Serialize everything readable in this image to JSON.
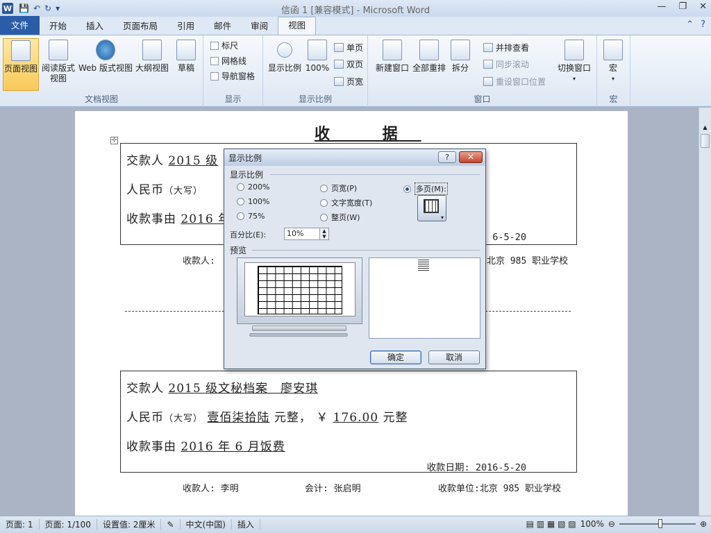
{
  "window": {
    "title": "信函 1 [兼容模式] - Microsoft Word",
    "word_logo": "W"
  },
  "ribbon": {
    "tabs": [
      "文件",
      "开始",
      "插入",
      "页面布局",
      "引用",
      "邮件",
      "审阅",
      "视图"
    ],
    "active_tab": "视图",
    "groups": {
      "doc_views": {
        "label": "文档视图",
        "buttons": [
          "页面视图",
          "阅读版式\n视图",
          "Web 版式视图",
          "大纲视图",
          "草稿"
        ]
      },
      "show": {
        "label": "显示",
        "items": [
          "标尺",
          "网格线",
          "导航窗格"
        ]
      },
      "zoom": {
        "label": "显示比例",
        "buttons": [
          "显示比例",
          "100%"
        ],
        "small": [
          "单页",
          "双页",
          "页宽"
        ]
      },
      "window": {
        "label": "窗口",
        "buttons": [
          "新建窗口",
          "全部重排",
          "拆分"
        ],
        "small": [
          "并排查看",
          "同步滚动",
          "重设窗口位置"
        ],
        "switch": "切换窗口"
      },
      "macro": {
        "label": "宏",
        "button": "宏"
      }
    }
  },
  "document": {
    "title": "收  据",
    "receipt1": {
      "payer_label": "交款人",
      "payer_value": "2015 级",
      "rmb_label": "人民币",
      "rmb_hint": "（大写）",
      "reason_label": "收款事由",
      "reason_value": "2016 年",
      "date": "6-5-20",
      "footer_left": "收款人:",
      "footer_right": "北京 985 职业学校"
    },
    "receipt2": {
      "payer_label": "交款人",
      "payer_value": "2015 级文秘档案　廖安琪",
      "rmb_label": "人民币",
      "rmb_hint": "（大写）",
      "rmb_amount": "壹佰柒拾陆",
      "rmb_unit1": "元整，",
      "currency": "￥",
      "amount": "176.00",
      "rmb_unit2": "元整",
      "reason_label": "收款事由",
      "reason_value": "2016 年 6 月饭费",
      "date_label": "收款日期:",
      "date_value": "2016-5-20",
      "footer_payee": "收款人: 李明",
      "footer_accountant": "会计: 张启明",
      "footer_unit": "收款单位:北京 985 职业学校"
    }
  },
  "dialog": {
    "title": "显示比例",
    "help": "?",
    "close": "✕",
    "section_zoom": "显示比例",
    "options": {
      "r200": "200%",
      "r100": "100%",
      "r75": "75%",
      "page_width": "页宽(P)",
      "text_width": "文字宽度(T)",
      "whole_page": "整页(W)",
      "many_pages": "多页(M):"
    },
    "selected": "many_pages",
    "percent_label": "百分比(E):",
    "percent_value": "10%",
    "section_preview": "预览",
    "ok": "确定",
    "cancel": "取消"
  },
  "statusbar": {
    "page": "页面: 1",
    "pages": "页面: 1/100",
    "setting": "设置值: 2厘米",
    "language": "中文(中国)",
    "mode": "插入",
    "zoom": "100%"
  }
}
